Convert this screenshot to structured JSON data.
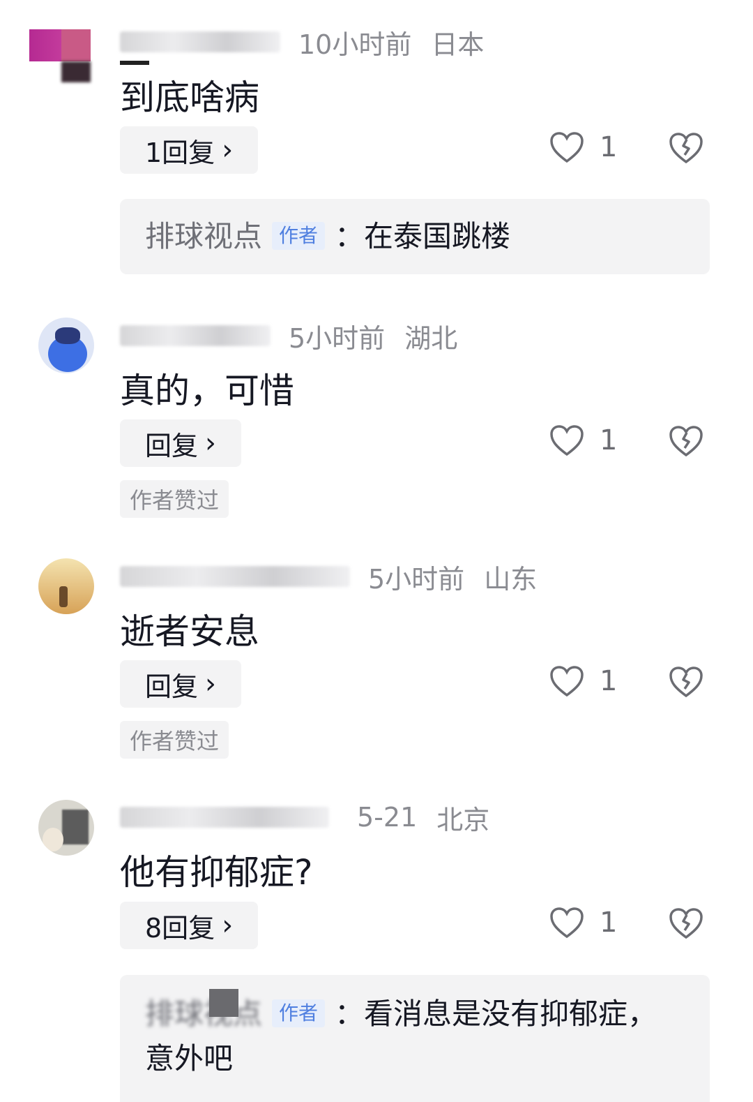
{
  "comments": [
    {
      "time": "10小时前",
      "location": "日本",
      "text": "到底啥病",
      "reply_label": "1回复",
      "like_count": "1",
      "author_reply": {
        "name": "排球视点",
        "tag": "作者",
        "sep": "：",
        "text": "在泰国跳楼"
      }
    },
    {
      "time": "5小时前",
      "location": "湖北",
      "text": "真的，可惜",
      "reply_label": "回复",
      "like_count": "1",
      "badge": "作者赞过"
    },
    {
      "time": "5小时前",
      "location": "山东",
      "text": "逝者安息",
      "reply_label": "回复",
      "like_count": "1",
      "badge": "作者赞过"
    },
    {
      "time": "5-21",
      "location": "北京",
      "text": "他有抑郁症?",
      "reply_label": "8回复",
      "like_count": "1",
      "author_reply": {
        "name": "排球视点",
        "tag": "作者",
        "sep": "：",
        "text": "看消息是没有抑郁症，意外吧"
      }
    }
  ],
  "icons": {
    "reply_chevron": "›",
    "like": "heart-outline-icon",
    "dislike": "broken-heart-icon"
  },
  "colors": {
    "text": "#161823",
    "meta": "#8a8b91",
    "button_bg": "#f3f3f4",
    "author_tag": "#4f7fe0"
  }
}
